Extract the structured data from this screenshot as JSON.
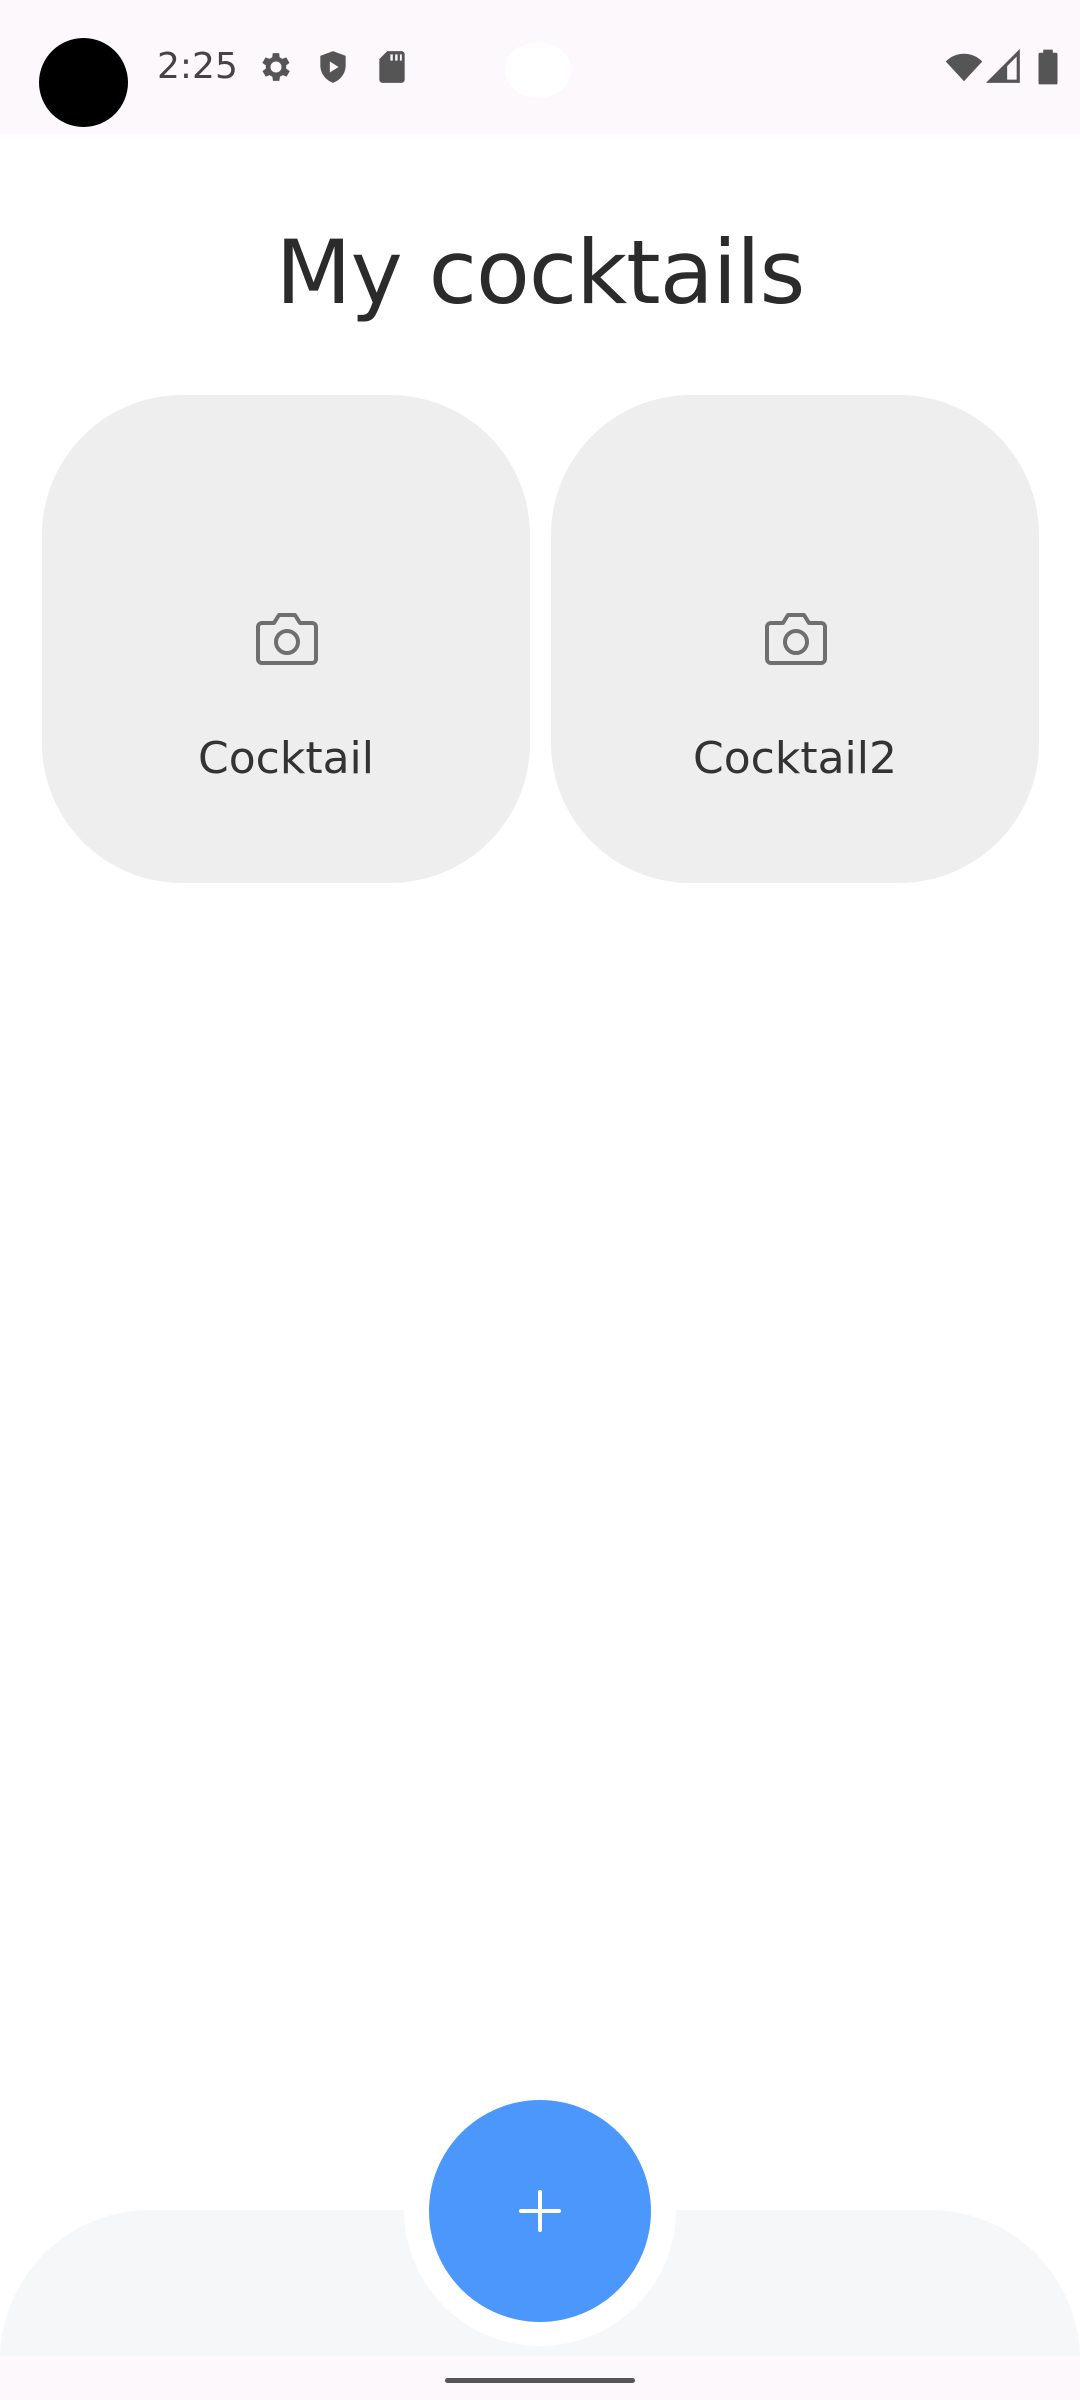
{
  "status_bar": {
    "time": "2:25",
    "left_icons": [
      "gear-icon",
      "shield-play-icon",
      "sd-card-icon"
    ],
    "right_icons": [
      "wifi-icon",
      "cell-signal-icon",
      "battery-icon"
    ]
  },
  "header": {
    "title": "My cocktails"
  },
  "cocktails": [
    {
      "name": "Cocktail",
      "icon": "camera-icon"
    },
    {
      "name": "Cocktail2",
      "icon": "camera-icon"
    }
  ],
  "fab": {
    "icon": "plus-icon",
    "color": "#4c97fc"
  },
  "colors": {
    "card_background": "#eeeeee",
    "bottom_bar": "#f6f7f9",
    "accent": "#4c97fc"
  }
}
